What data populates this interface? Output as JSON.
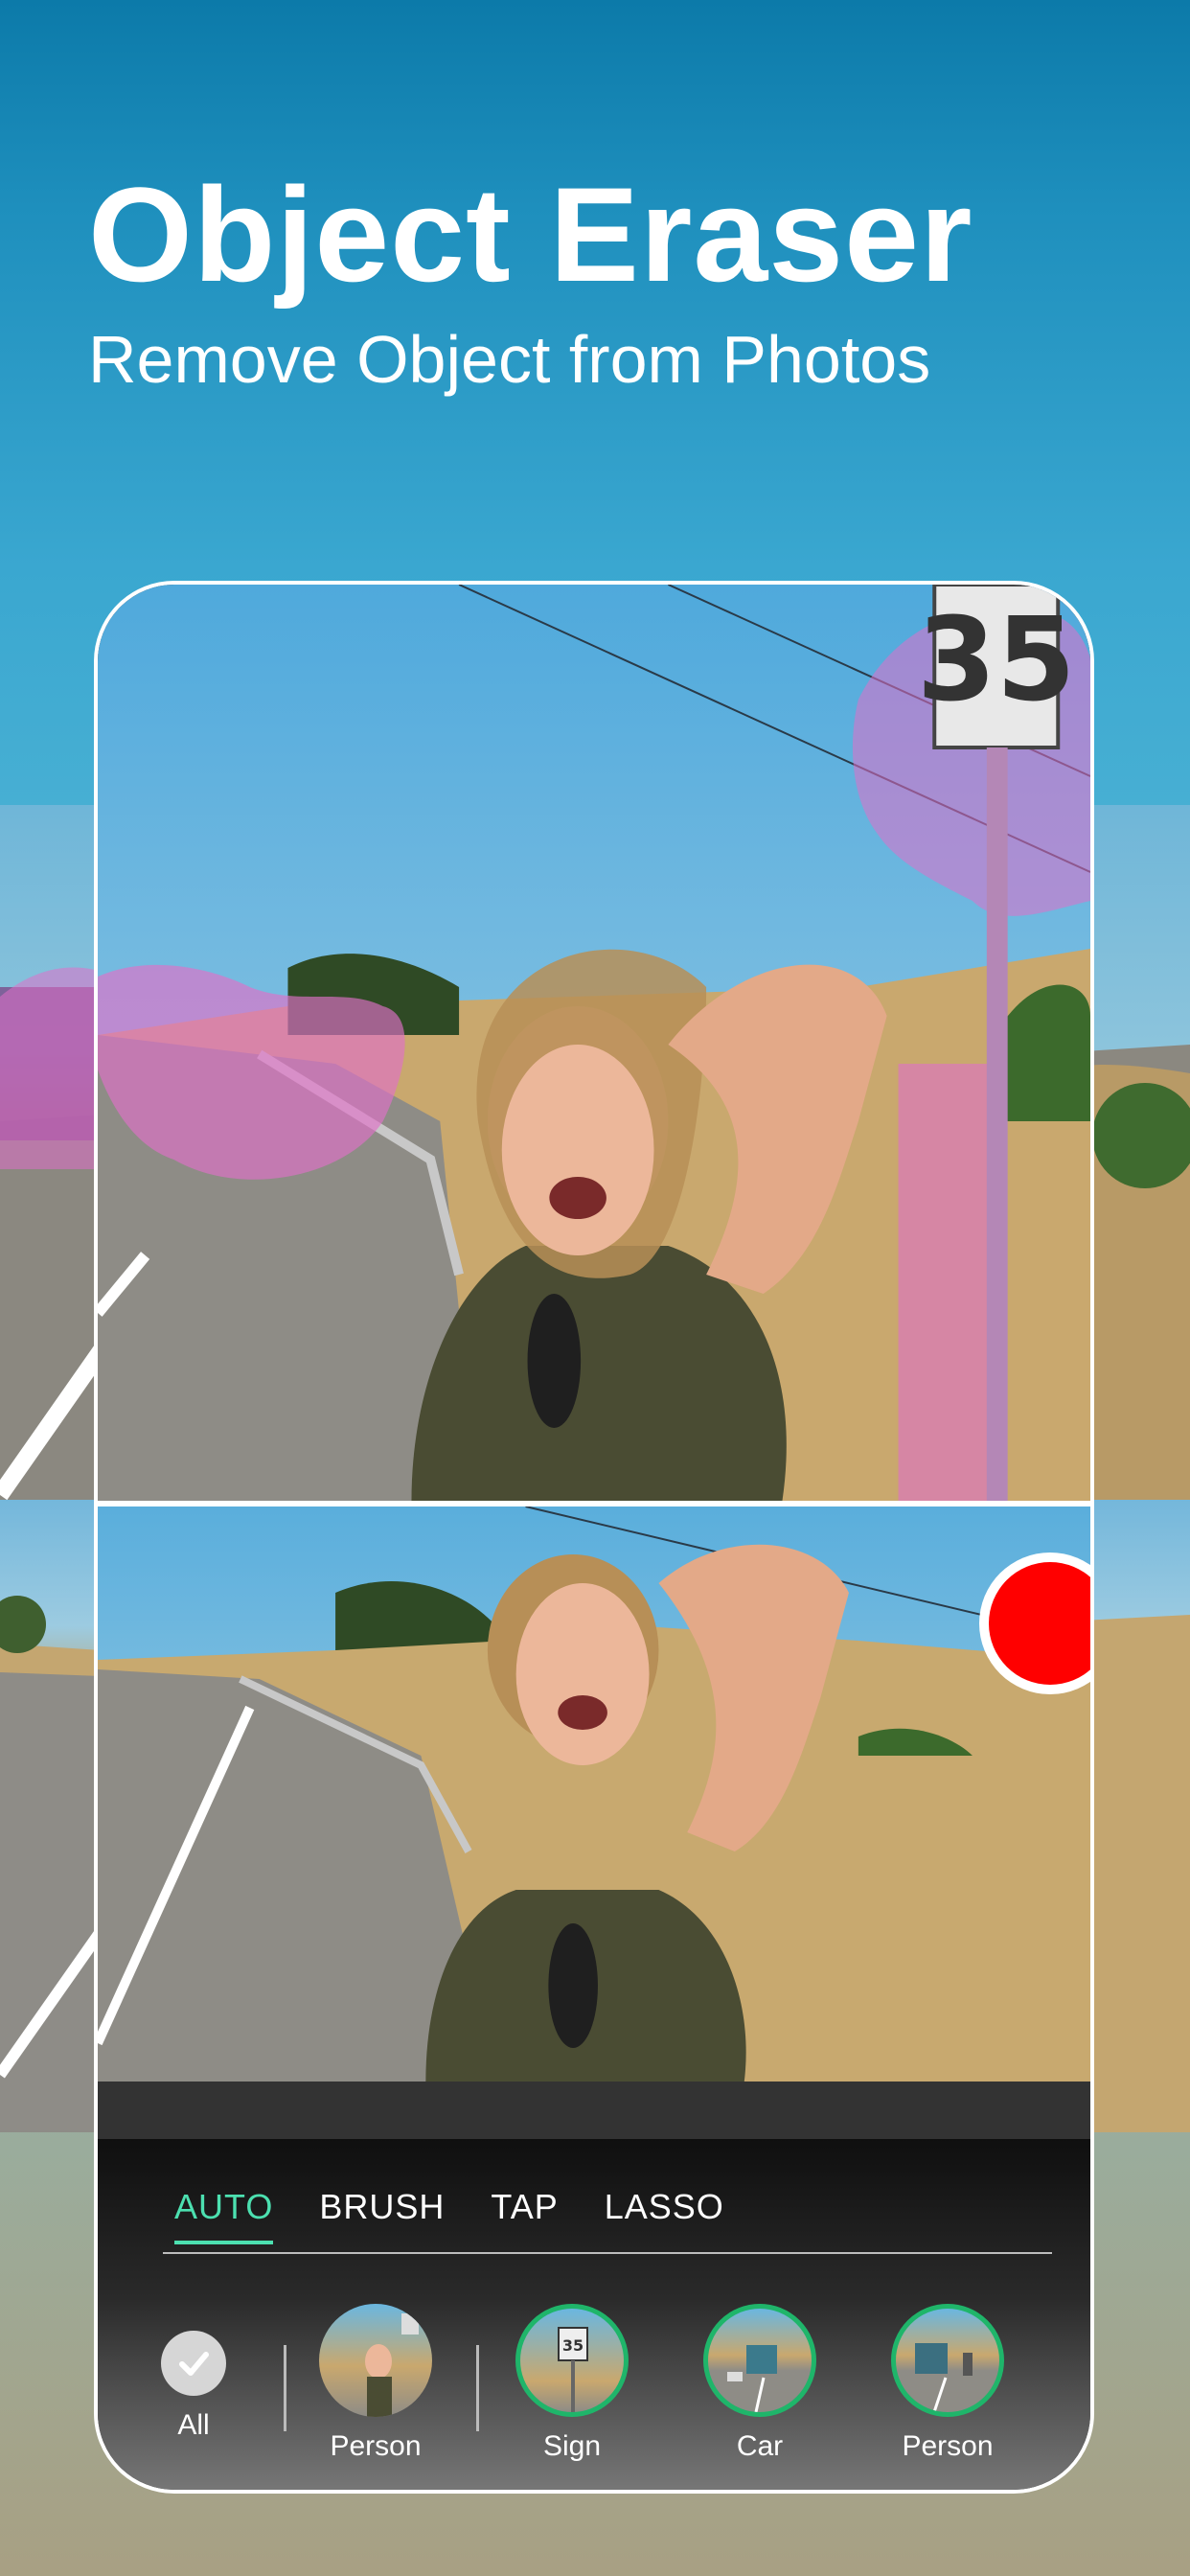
{
  "header": {
    "title": "Object Eraser",
    "subtitle": "Remove Object from Photos"
  },
  "sign_text": "35",
  "toolbar": {
    "tabs": [
      {
        "label": "AUTO",
        "active": true
      },
      {
        "label": "BRUSH",
        "active": false
      },
      {
        "label": "TAP",
        "active": false
      },
      {
        "label": "LASSO",
        "active": false
      }
    ],
    "all_label": "All",
    "objects": [
      {
        "label": "Person",
        "icon": "person-thumb"
      },
      {
        "label": "Sign",
        "icon": "sign-thumb"
      },
      {
        "label": "Car",
        "icon": "car-thumb"
      },
      {
        "label": "Person",
        "icon": "truck-person-thumb"
      }
    ]
  },
  "colors": {
    "accent": "#4ce0b0",
    "mask": "#e070c8",
    "record": "#ff0000"
  }
}
